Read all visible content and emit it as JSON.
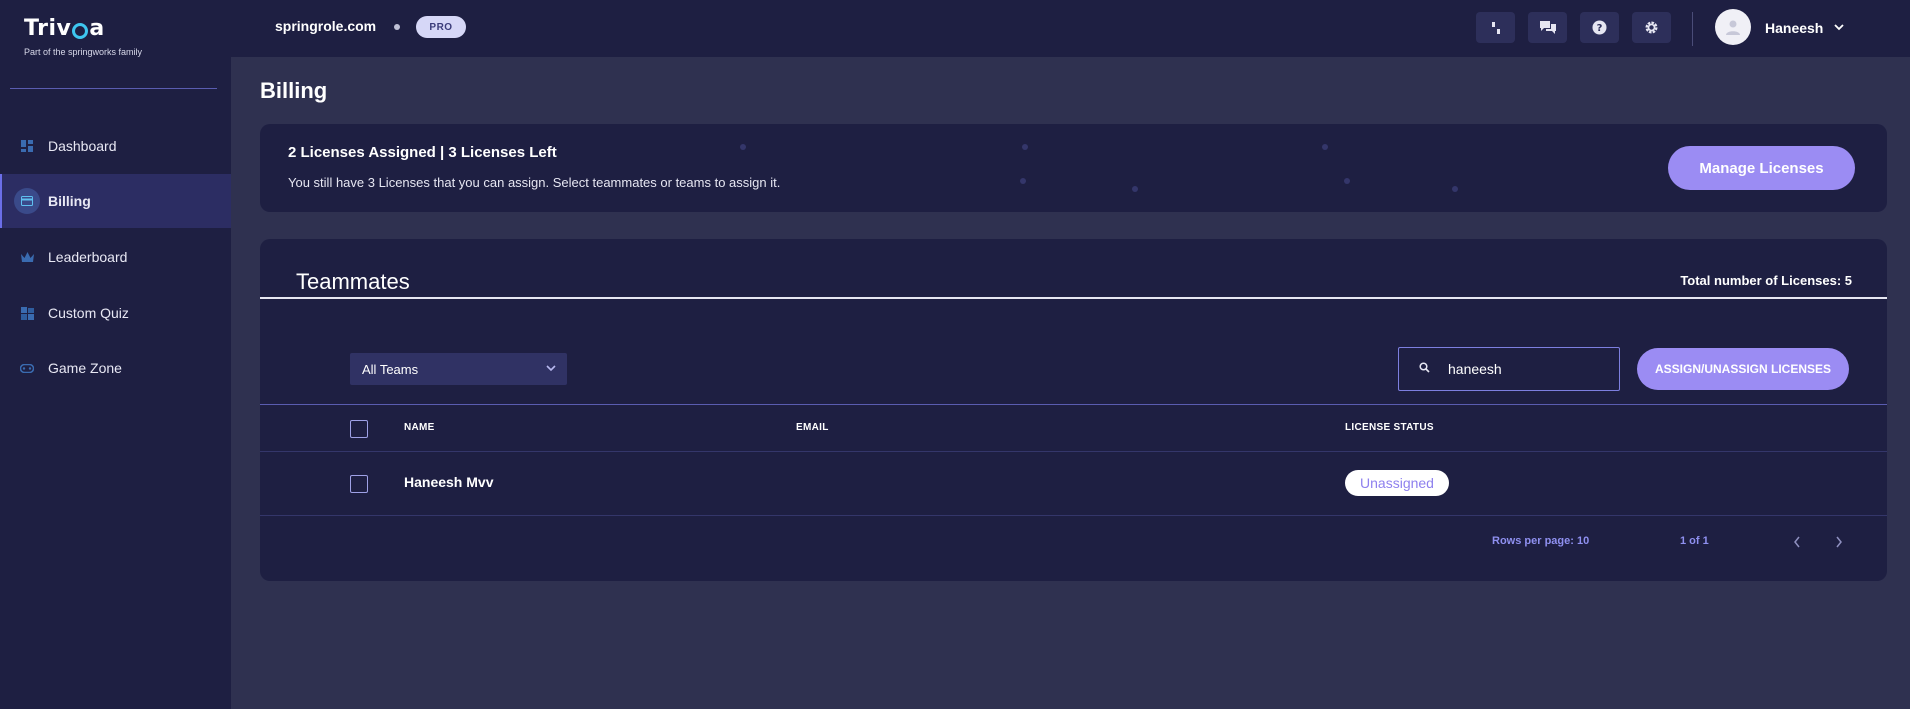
{
  "brand": {
    "logo_text_a": "Triv",
    "logo_text_b": "a",
    "tagline": "Part of the springworks family"
  },
  "sidebar": {
    "items": [
      {
        "label": "Dashboard",
        "icon": "dashboard-icon"
      },
      {
        "label": "Billing",
        "icon": "billing-card-icon",
        "active": true
      },
      {
        "label": "Leaderboard",
        "icon": "crown-icon"
      },
      {
        "label": "Custom Quiz",
        "icon": "custom-quiz-icon"
      },
      {
        "label": "Game Zone",
        "icon": "game-controller-icon"
      }
    ]
  },
  "topbar": {
    "org_name": "springrole.com",
    "plan_badge": "PRO",
    "user_name": "Haneesh",
    "icons": [
      "feedback-icon",
      "chat-icon",
      "help-icon",
      "settings-icon"
    ]
  },
  "page": {
    "title": "Billing"
  },
  "license_summary": {
    "heading": "2 Licenses Assigned | 3 Licenses Left",
    "text": "You still have 3 Licenses that you can assign. Select teammates or teams to assign it.",
    "manage_button": "Manage Licenses"
  },
  "teammates": {
    "title": "Teammates",
    "total_licenses": "Total number of Licenses: 5",
    "team_filter": "All Teams",
    "search_value": "haneesh",
    "assign_button": "ASSIGN/UNASSIGN LICENSES",
    "columns": [
      "NAME",
      "EMAIL",
      "LICENSE STATUS"
    ],
    "rows": [
      {
        "name": "Haneesh Mvv",
        "email": "",
        "status": "Unassigned"
      }
    ],
    "rows_per_page": "Rows per page: 10",
    "page_info": "1 of 1"
  },
  "colors": {
    "sidebar_bg": "#1e1f42",
    "page_bg": "#2f3150",
    "accent": "#9b8cf3"
  }
}
